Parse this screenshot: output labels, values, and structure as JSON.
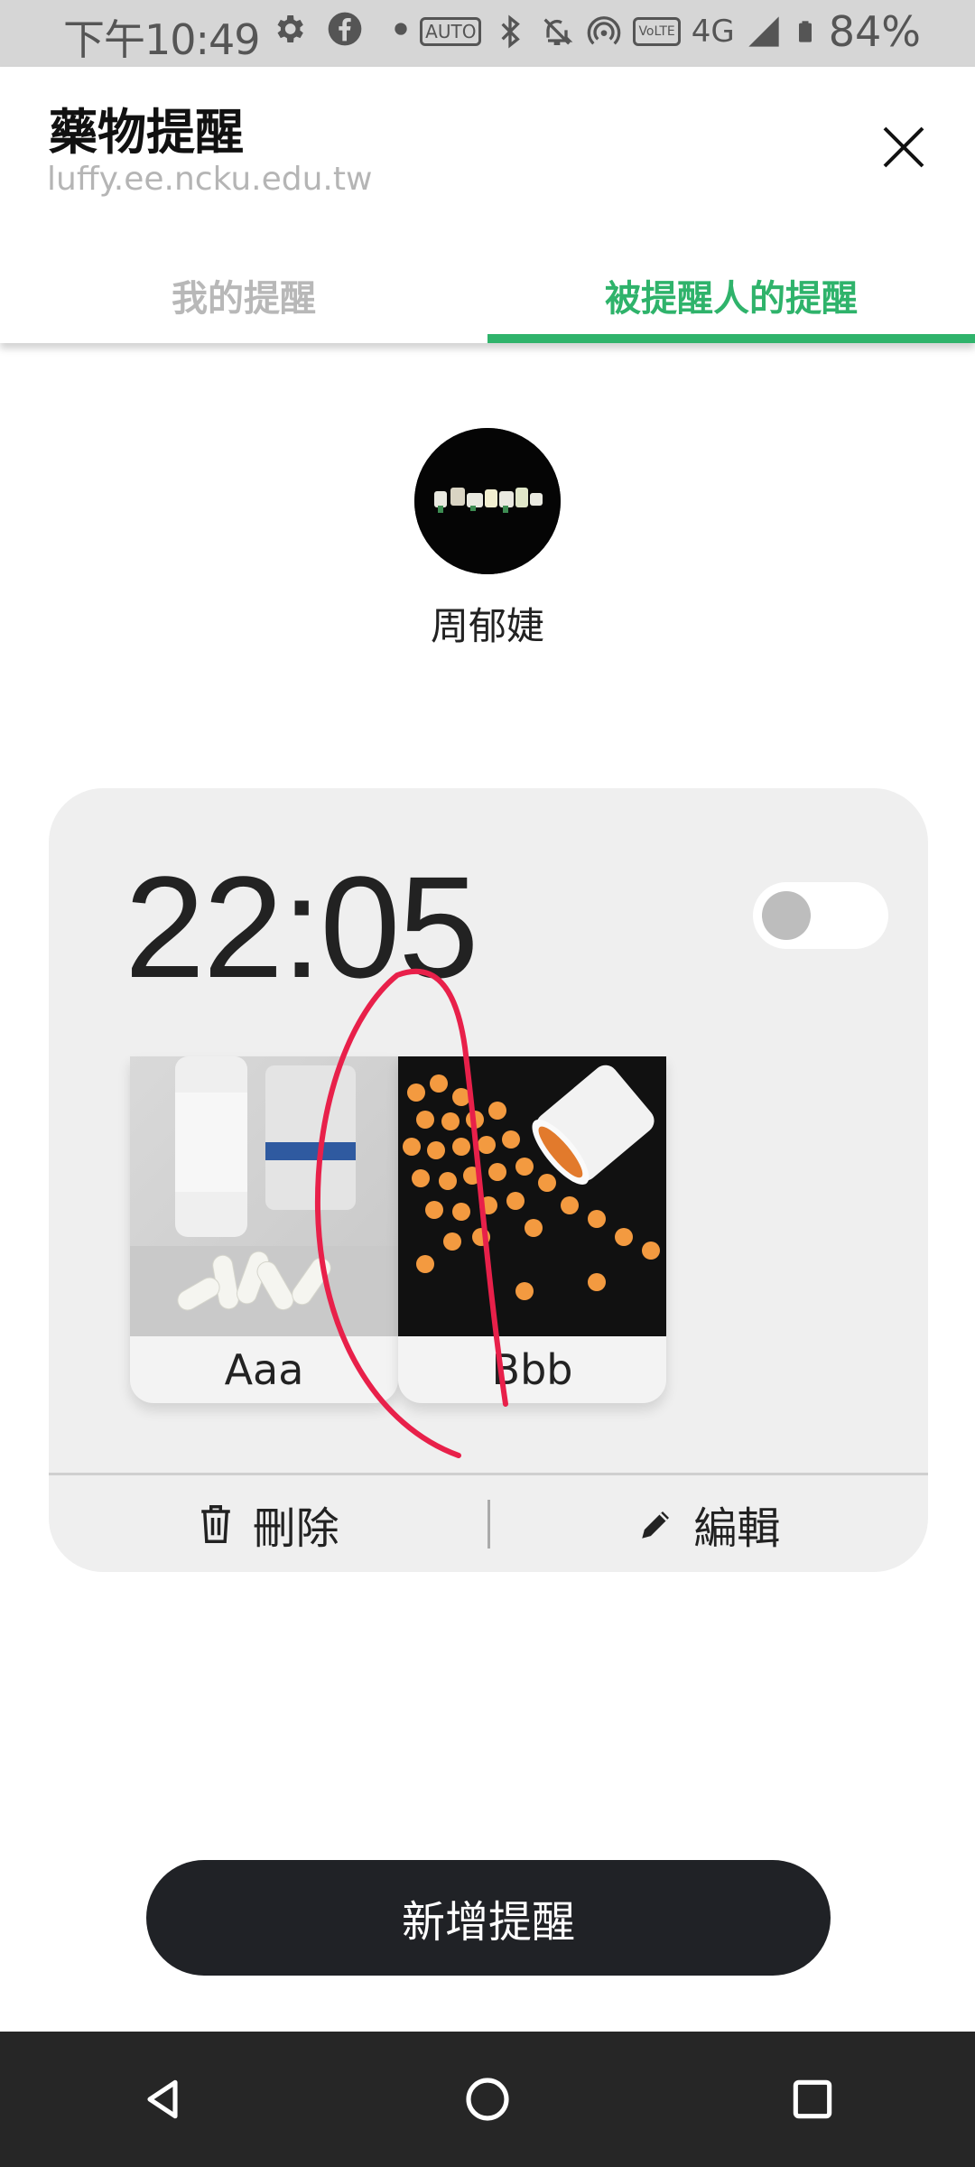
{
  "status_bar": {
    "time": "下午10:49",
    "battery": "84%",
    "network": "4G",
    "volte": "VoLTE",
    "auto_hz": "AUTO",
    "icons": [
      "gear-icon",
      "facebook-icon",
      "dot-icon",
      "auto-hz-icon",
      "bluetooth-icon",
      "mute-icon",
      "hotspot-icon",
      "volte-icon",
      "4g-icon",
      "signal-icon",
      "battery-icon"
    ]
  },
  "header": {
    "title": "藥物提醒",
    "url": "luffy.ee.ncku.edu.tw",
    "close_icon": "close-icon"
  },
  "tabs": [
    {
      "label": "我的提醒",
      "active": false
    },
    {
      "label": "被提醒人的提醒",
      "active": true
    }
  ],
  "profile": {
    "name": "周郁婕"
  },
  "reminder": {
    "time": "22:05",
    "enabled": false,
    "medications": [
      {
        "label": "Aaa"
      },
      {
        "label": "Bbb"
      }
    ],
    "actions": {
      "delete_label": "刪除",
      "edit_label": "編輯"
    }
  },
  "add_button": {
    "label": "新增提醒"
  },
  "colors": {
    "accent": "#2fb36b",
    "button_bg": "#202226",
    "card_bg": "#efefef",
    "annotation": "#e8204a"
  },
  "navbar": {
    "icons": [
      "back-icon",
      "home-icon",
      "recents-icon"
    ]
  }
}
